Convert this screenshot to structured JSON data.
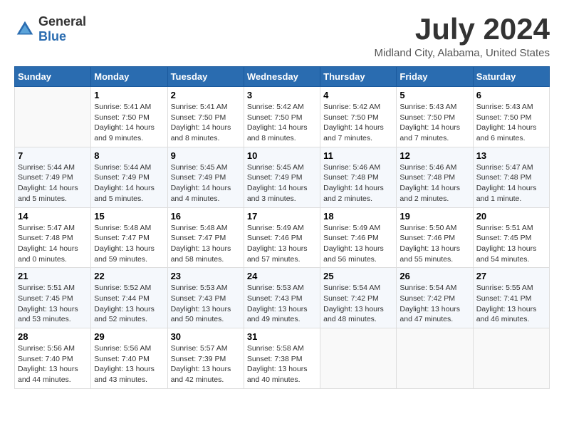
{
  "logo": {
    "general": "General",
    "blue": "Blue"
  },
  "title": "July 2024",
  "location": "Midland City, Alabama, United States",
  "days_of_week": [
    "Sunday",
    "Monday",
    "Tuesday",
    "Wednesday",
    "Thursday",
    "Friday",
    "Saturday"
  ],
  "weeks": [
    [
      {
        "day": "",
        "info": ""
      },
      {
        "day": "1",
        "info": "Sunrise: 5:41 AM\nSunset: 7:50 PM\nDaylight: 14 hours\nand 9 minutes."
      },
      {
        "day": "2",
        "info": "Sunrise: 5:41 AM\nSunset: 7:50 PM\nDaylight: 14 hours\nand 8 minutes."
      },
      {
        "day": "3",
        "info": "Sunrise: 5:42 AM\nSunset: 7:50 PM\nDaylight: 14 hours\nand 8 minutes."
      },
      {
        "day": "4",
        "info": "Sunrise: 5:42 AM\nSunset: 7:50 PM\nDaylight: 14 hours\nand 7 minutes."
      },
      {
        "day": "5",
        "info": "Sunrise: 5:43 AM\nSunset: 7:50 PM\nDaylight: 14 hours\nand 7 minutes."
      },
      {
        "day": "6",
        "info": "Sunrise: 5:43 AM\nSunset: 7:50 PM\nDaylight: 14 hours\nand 6 minutes."
      }
    ],
    [
      {
        "day": "7",
        "info": "Sunrise: 5:44 AM\nSunset: 7:49 PM\nDaylight: 14 hours\nand 5 minutes."
      },
      {
        "day": "8",
        "info": "Sunrise: 5:44 AM\nSunset: 7:49 PM\nDaylight: 14 hours\nand 5 minutes."
      },
      {
        "day": "9",
        "info": "Sunrise: 5:45 AM\nSunset: 7:49 PM\nDaylight: 14 hours\nand 4 minutes."
      },
      {
        "day": "10",
        "info": "Sunrise: 5:45 AM\nSunset: 7:49 PM\nDaylight: 14 hours\nand 3 minutes."
      },
      {
        "day": "11",
        "info": "Sunrise: 5:46 AM\nSunset: 7:48 PM\nDaylight: 14 hours\nand 2 minutes."
      },
      {
        "day": "12",
        "info": "Sunrise: 5:46 AM\nSunset: 7:48 PM\nDaylight: 14 hours\nand 2 minutes."
      },
      {
        "day": "13",
        "info": "Sunrise: 5:47 AM\nSunset: 7:48 PM\nDaylight: 14 hours\nand 1 minute."
      }
    ],
    [
      {
        "day": "14",
        "info": "Sunrise: 5:47 AM\nSunset: 7:48 PM\nDaylight: 14 hours\nand 0 minutes."
      },
      {
        "day": "15",
        "info": "Sunrise: 5:48 AM\nSunset: 7:47 PM\nDaylight: 13 hours\nand 59 minutes."
      },
      {
        "day": "16",
        "info": "Sunrise: 5:48 AM\nSunset: 7:47 PM\nDaylight: 13 hours\nand 58 minutes."
      },
      {
        "day": "17",
        "info": "Sunrise: 5:49 AM\nSunset: 7:46 PM\nDaylight: 13 hours\nand 57 minutes."
      },
      {
        "day": "18",
        "info": "Sunrise: 5:49 AM\nSunset: 7:46 PM\nDaylight: 13 hours\nand 56 minutes."
      },
      {
        "day": "19",
        "info": "Sunrise: 5:50 AM\nSunset: 7:46 PM\nDaylight: 13 hours\nand 55 minutes."
      },
      {
        "day": "20",
        "info": "Sunrise: 5:51 AM\nSunset: 7:45 PM\nDaylight: 13 hours\nand 54 minutes."
      }
    ],
    [
      {
        "day": "21",
        "info": "Sunrise: 5:51 AM\nSunset: 7:45 PM\nDaylight: 13 hours\nand 53 minutes."
      },
      {
        "day": "22",
        "info": "Sunrise: 5:52 AM\nSunset: 7:44 PM\nDaylight: 13 hours\nand 52 minutes."
      },
      {
        "day": "23",
        "info": "Sunrise: 5:53 AM\nSunset: 7:43 PM\nDaylight: 13 hours\nand 50 minutes."
      },
      {
        "day": "24",
        "info": "Sunrise: 5:53 AM\nSunset: 7:43 PM\nDaylight: 13 hours\nand 49 minutes."
      },
      {
        "day": "25",
        "info": "Sunrise: 5:54 AM\nSunset: 7:42 PM\nDaylight: 13 hours\nand 48 minutes."
      },
      {
        "day": "26",
        "info": "Sunrise: 5:54 AM\nSunset: 7:42 PM\nDaylight: 13 hours\nand 47 minutes."
      },
      {
        "day": "27",
        "info": "Sunrise: 5:55 AM\nSunset: 7:41 PM\nDaylight: 13 hours\nand 46 minutes."
      }
    ],
    [
      {
        "day": "28",
        "info": "Sunrise: 5:56 AM\nSunset: 7:40 PM\nDaylight: 13 hours\nand 44 minutes."
      },
      {
        "day": "29",
        "info": "Sunrise: 5:56 AM\nSunset: 7:40 PM\nDaylight: 13 hours\nand 43 minutes."
      },
      {
        "day": "30",
        "info": "Sunrise: 5:57 AM\nSunset: 7:39 PM\nDaylight: 13 hours\nand 42 minutes."
      },
      {
        "day": "31",
        "info": "Sunrise: 5:58 AM\nSunset: 7:38 PM\nDaylight: 13 hours\nand 40 minutes."
      },
      {
        "day": "",
        "info": ""
      },
      {
        "day": "",
        "info": ""
      },
      {
        "day": "",
        "info": ""
      }
    ]
  ]
}
